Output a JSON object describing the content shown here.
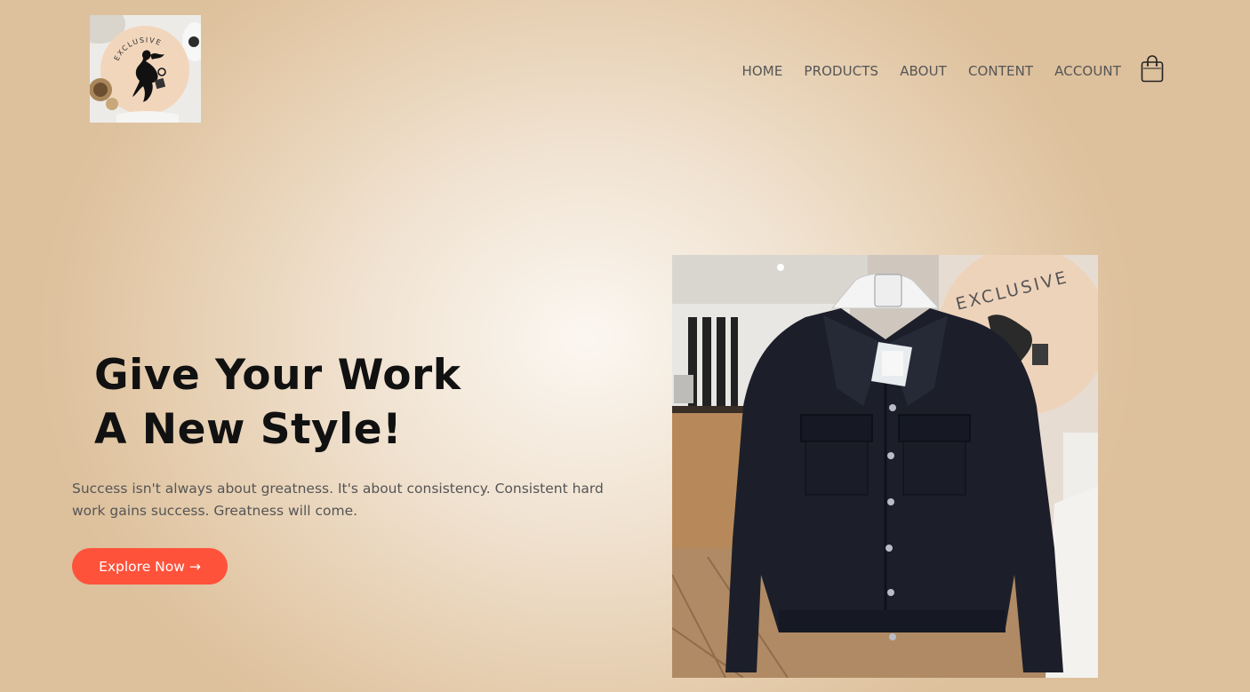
{
  "brand": {
    "logo_text": "EXCLUSIVE",
    "logo_icon": "woman-silhouette-logo"
  },
  "nav": {
    "items": [
      {
        "label": "HOME"
      },
      {
        "label": "PRODUCTS"
      },
      {
        "label": "ABOUT"
      },
      {
        "label": "CONTENT"
      },
      {
        "label": "ACCOUNT"
      }
    ],
    "cart_icon": "shopping-bag-icon"
  },
  "hero": {
    "title_line1": "Give Your Work",
    "title_line2": "A New Style!",
    "description": "Success isn't always about greatness. It's about consistency. Consistent hard work gains success. Greatness will come.",
    "cta_label": "Explore Now",
    "cta_arrow": "→",
    "image_caption_text": "EXCLUSIVE"
  },
  "colors": {
    "accent": "#ff523b",
    "heading": "#111111",
    "body_text": "#555555",
    "background": "#e4cbab"
  }
}
